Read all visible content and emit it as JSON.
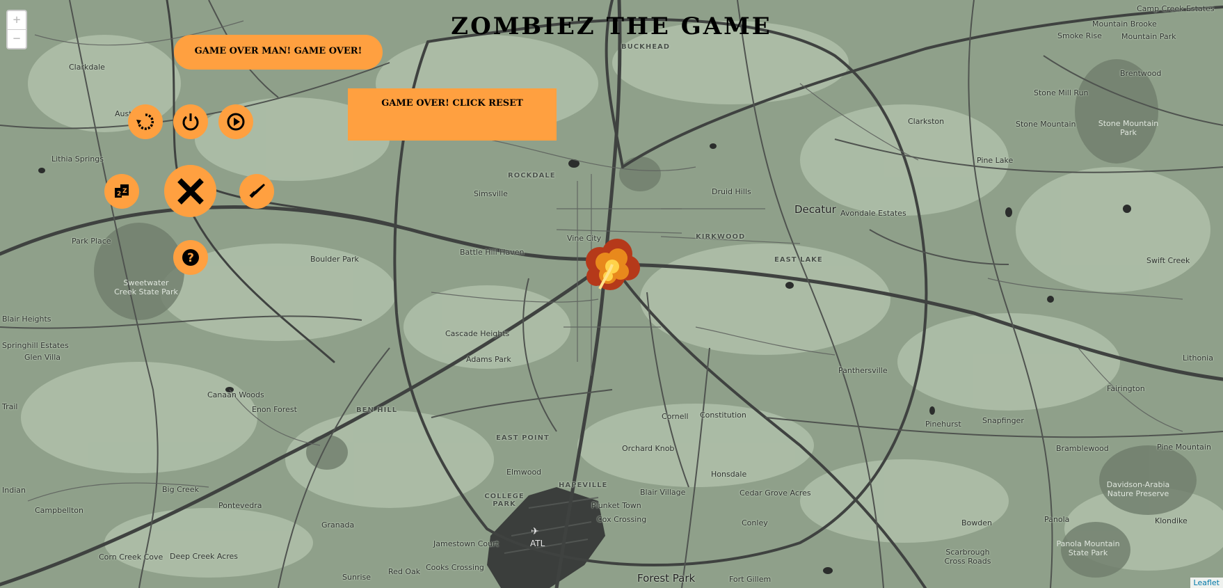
{
  "title": "ZOMBIEZ  THE GAME",
  "banner_text": "GAME OVER MAN! GAME OVER!",
  "message_box_text": "GAME OVER! CLICK RESET",
  "zoom": {
    "in_label": "+",
    "out_label": "−"
  },
  "attribution": "Leaflet",
  "controls": [
    {
      "name": "reset-button",
      "icon": "reset-icon"
    },
    {
      "name": "power-button",
      "icon": "power-icon"
    },
    {
      "name": "play-button",
      "icon": "play-icon"
    },
    {
      "name": "zombie-count-button",
      "icon": "zombie-icon"
    },
    {
      "name": "close-button",
      "icon": "close-icon"
    },
    {
      "name": "weapon-button",
      "icon": "knife-icon"
    },
    {
      "name": "help-button",
      "icon": "question-icon"
    }
  ],
  "colors": {
    "accent": "#ffa040",
    "map_base": "#8fa08a",
    "road": "#3f4240"
  },
  "map_labels": {
    "camp_creek_estates": "Camp Creek Estates",
    "mountain_brooke": "Mountain Brooke",
    "smoke_rise": "Smoke Rise",
    "mountain_park": "Mountain Park",
    "brentwood": "Brentwood",
    "stone_mill_run": "Stone Mill Run",
    "stone_mountain": "Stone Mountain",
    "stone_mountain_park": "Stone Mountain Park",
    "clarkdale": "Clarkdale",
    "buckhead": "BUCKHEAD",
    "austell": "Austell",
    "clarkston": "Clarkston",
    "lithia_springs": "Lithia Springs",
    "pine_lake": "Pine Lake",
    "rockdale": "ROCKDALE",
    "simsville": "Simsville",
    "druid_hills": "Druid Hills",
    "decatur": "Decatur",
    "avondale_estates": "Avondale Estates",
    "park_place": "Park Place",
    "vine_city": "Vine City",
    "kirkwood": "KIRKWOOD",
    "boulder_park": "Boulder Park",
    "battle_hill_haven": "Battle Hill Haven",
    "east_lake": "EAST LAKE",
    "swift_creek": "Swift Creek",
    "sweetwater": "Sweetwater Creek State Park",
    "blair_heights": "Blair Heights",
    "cascade_heights": "Cascade Heights",
    "springhill_estates": "Springhill Estates",
    "glen_villa": "Glen Villa",
    "adams_park": "Adams Park",
    "panthersville": "Panthersville",
    "lithonia": "Lithonia",
    "trail": "Trail",
    "canaan_woods": "Canaan Woods",
    "enon_forest": "Enon Forest",
    "ben_hill": "BEN HILL",
    "cornell": "Cornell",
    "constitution": "Constitution",
    "fairington": "Fairington",
    "pinehurst": "Pinehurst",
    "snapfinger": "Snapfinger",
    "east_point": "EAST POINT",
    "orchard_knob": "Orchard Knob",
    "bramblewood": "Bramblewood",
    "pine_mountain": "Pine Mountain",
    "elmwood": "Elmwood",
    "hapeville": "HAPEVILLE",
    "big_creek": "Big Creek",
    "college_park": "COLLEGE PARK",
    "blair_village": "Blair Village",
    "honsdale": "Honsdale",
    "cedar_grove_acres": "Cedar Grove Acres",
    "davidson_arabia": "Davidson-Arabia Nature Preserve",
    "indian": "Indian",
    "campbellton": "Campbellton",
    "pontevedra": "Pontevedra",
    "plunket_town": "Plunket Town",
    "cox_crossing": "Cox Crossing",
    "granada": "Granada",
    "conley": "Conley",
    "bowden": "Bowden",
    "panola": "Panola",
    "klondike": "Klondike",
    "atl": "ATL",
    "jamestown_court": "Jamestown Court",
    "panola_mountain": "Panola Mountain State Park",
    "corn_creek_cove": "Corn Creek Cove",
    "deep_creek_acres": "Deep Creek Acres",
    "scarbrough_cross_roads": "Scarbrough Cross Roads",
    "sunrise": "Sunrise",
    "red_oak": "Red Oak",
    "cooks_crossing": "Cooks Crossing",
    "forest_park": "Forest Park",
    "fort_gillem": "Fort Gillem"
  }
}
